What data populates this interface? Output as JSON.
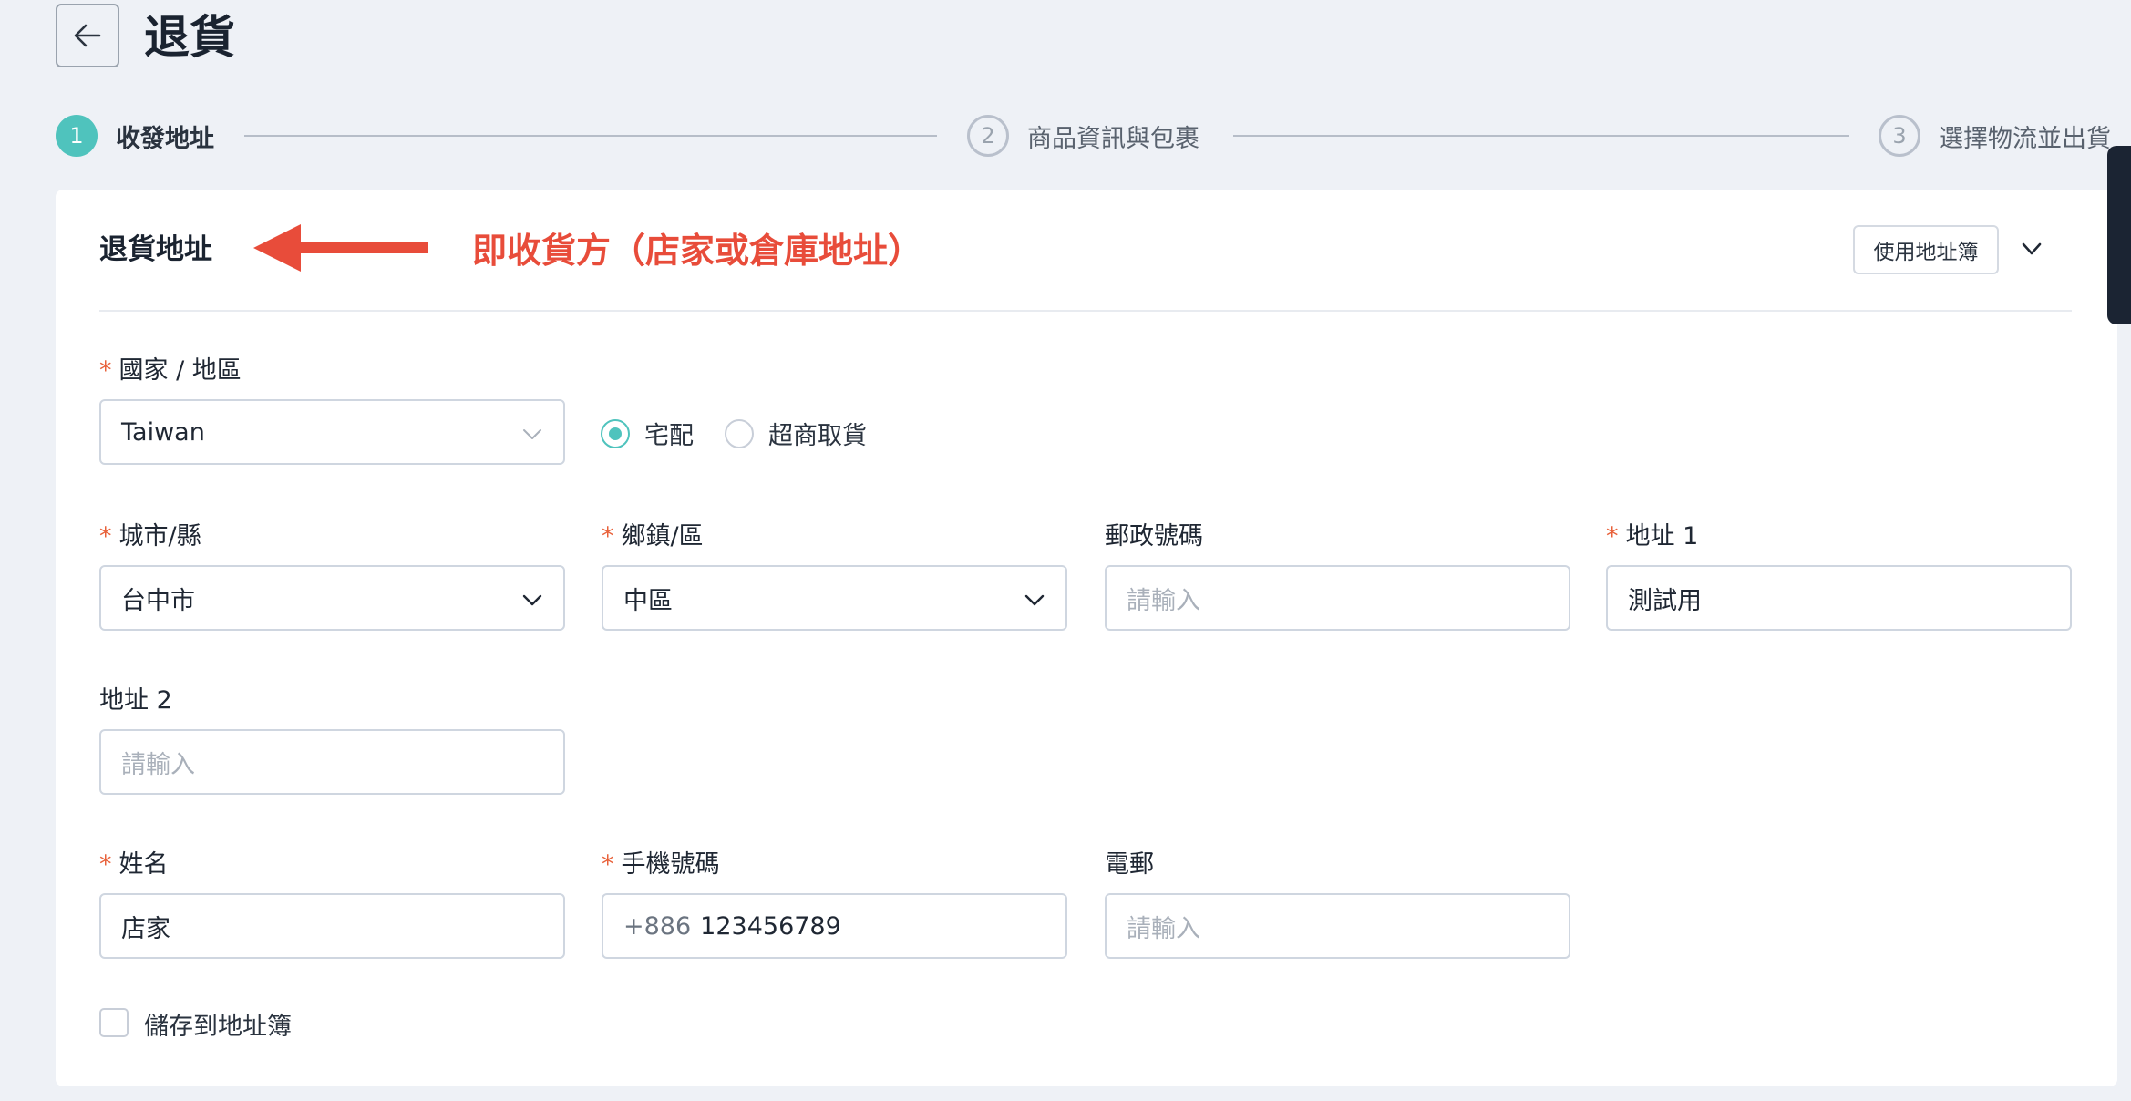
{
  "header": {
    "title": "退貨"
  },
  "stepper": {
    "steps": [
      {
        "number": "1",
        "label": "收發地址"
      },
      {
        "number": "2",
        "label": "商品資訊與包裹"
      },
      {
        "number": "3",
        "label": "選擇物流並出貨"
      }
    ]
  },
  "card": {
    "title": "退貨地址",
    "annotation": "即收貨方（店家或倉庫地址）",
    "address_book_button": "使用地址簿"
  },
  "form": {
    "country": {
      "label": "國家 / 地區",
      "value": "Taiwan"
    },
    "delivery_options": [
      {
        "label": "宅配",
        "checked": true
      },
      {
        "label": "超商取貨",
        "checked": false
      }
    ],
    "city": {
      "label": "城市/縣",
      "value": "台中市"
    },
    "district": {
      "label": "鄉鎮/區",
      "value": "中區"
    },
    "postal_code": {
      "label": "郵政號碼",
      "placeholder": "請輸入"
    },
    "address1": {
      "label": "地址 1",
      "value": "測試用"
    },
    "address2": {
      "label": "地址 2",
      "placeholder": "請輸入"
    },
    "name": {
      "label": "姓名",
      "value": "店家"
    },
    "phone": {
      "label": "手機號碼",
      "prefix": "+886",
      "value": "123456789"
    },
    "email": {
      "label": "電郵",
      "placeholder": "請輸入"
    },
    "save_to_address_book": {
      "label": "儲存到地址簿",
      "checked": false
    }
  },
  "colors": {
    "accent": "#4fc3bd",
    "annotation": "#e84c3a",
    "required": "#e8613a"
  },
  "icons": {
    "back": "arrow-left-icon",
    "collapse": "chevron-down-icon",
    "select": "chevron-down-icon"
  }
}
